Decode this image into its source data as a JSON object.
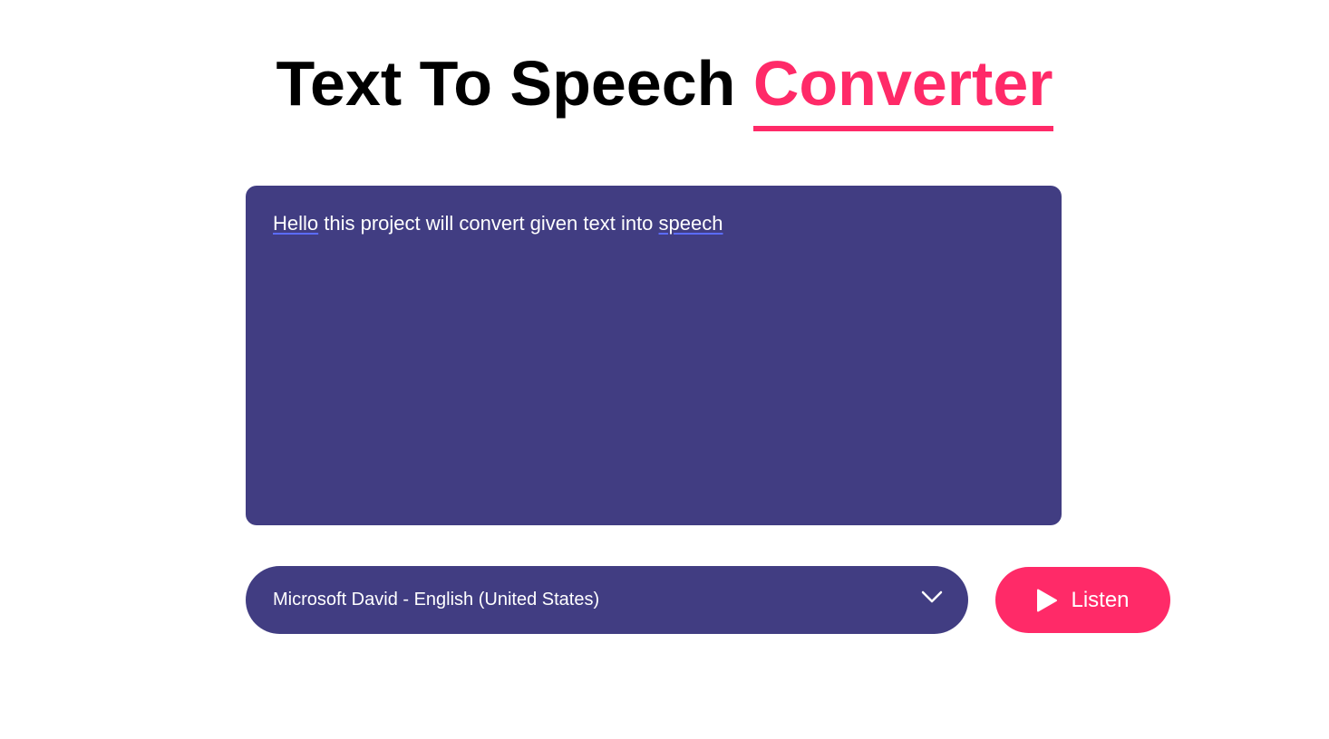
{
  "header": {
    "title_main": "Text To Speech",
    "title_accent": "Converter"
  },
  "textarea": {
    "value_prefix": "Hello",
    "value_middle": " this project will convert given text into ",
    "value_suffix": "speech"
  },
  "voice_select": {
    "selected": "Microsoft David - English (United States)"
  },
  "listen_button": {
    "label": "Listen"
  },
  "colors": {
    "accent": "#ff2a68",
    "panel": "#413d82"
  },
  "icons": {
    "dropdown": "chevron-down-icon",
    "play": "play-icon"
  }
}
